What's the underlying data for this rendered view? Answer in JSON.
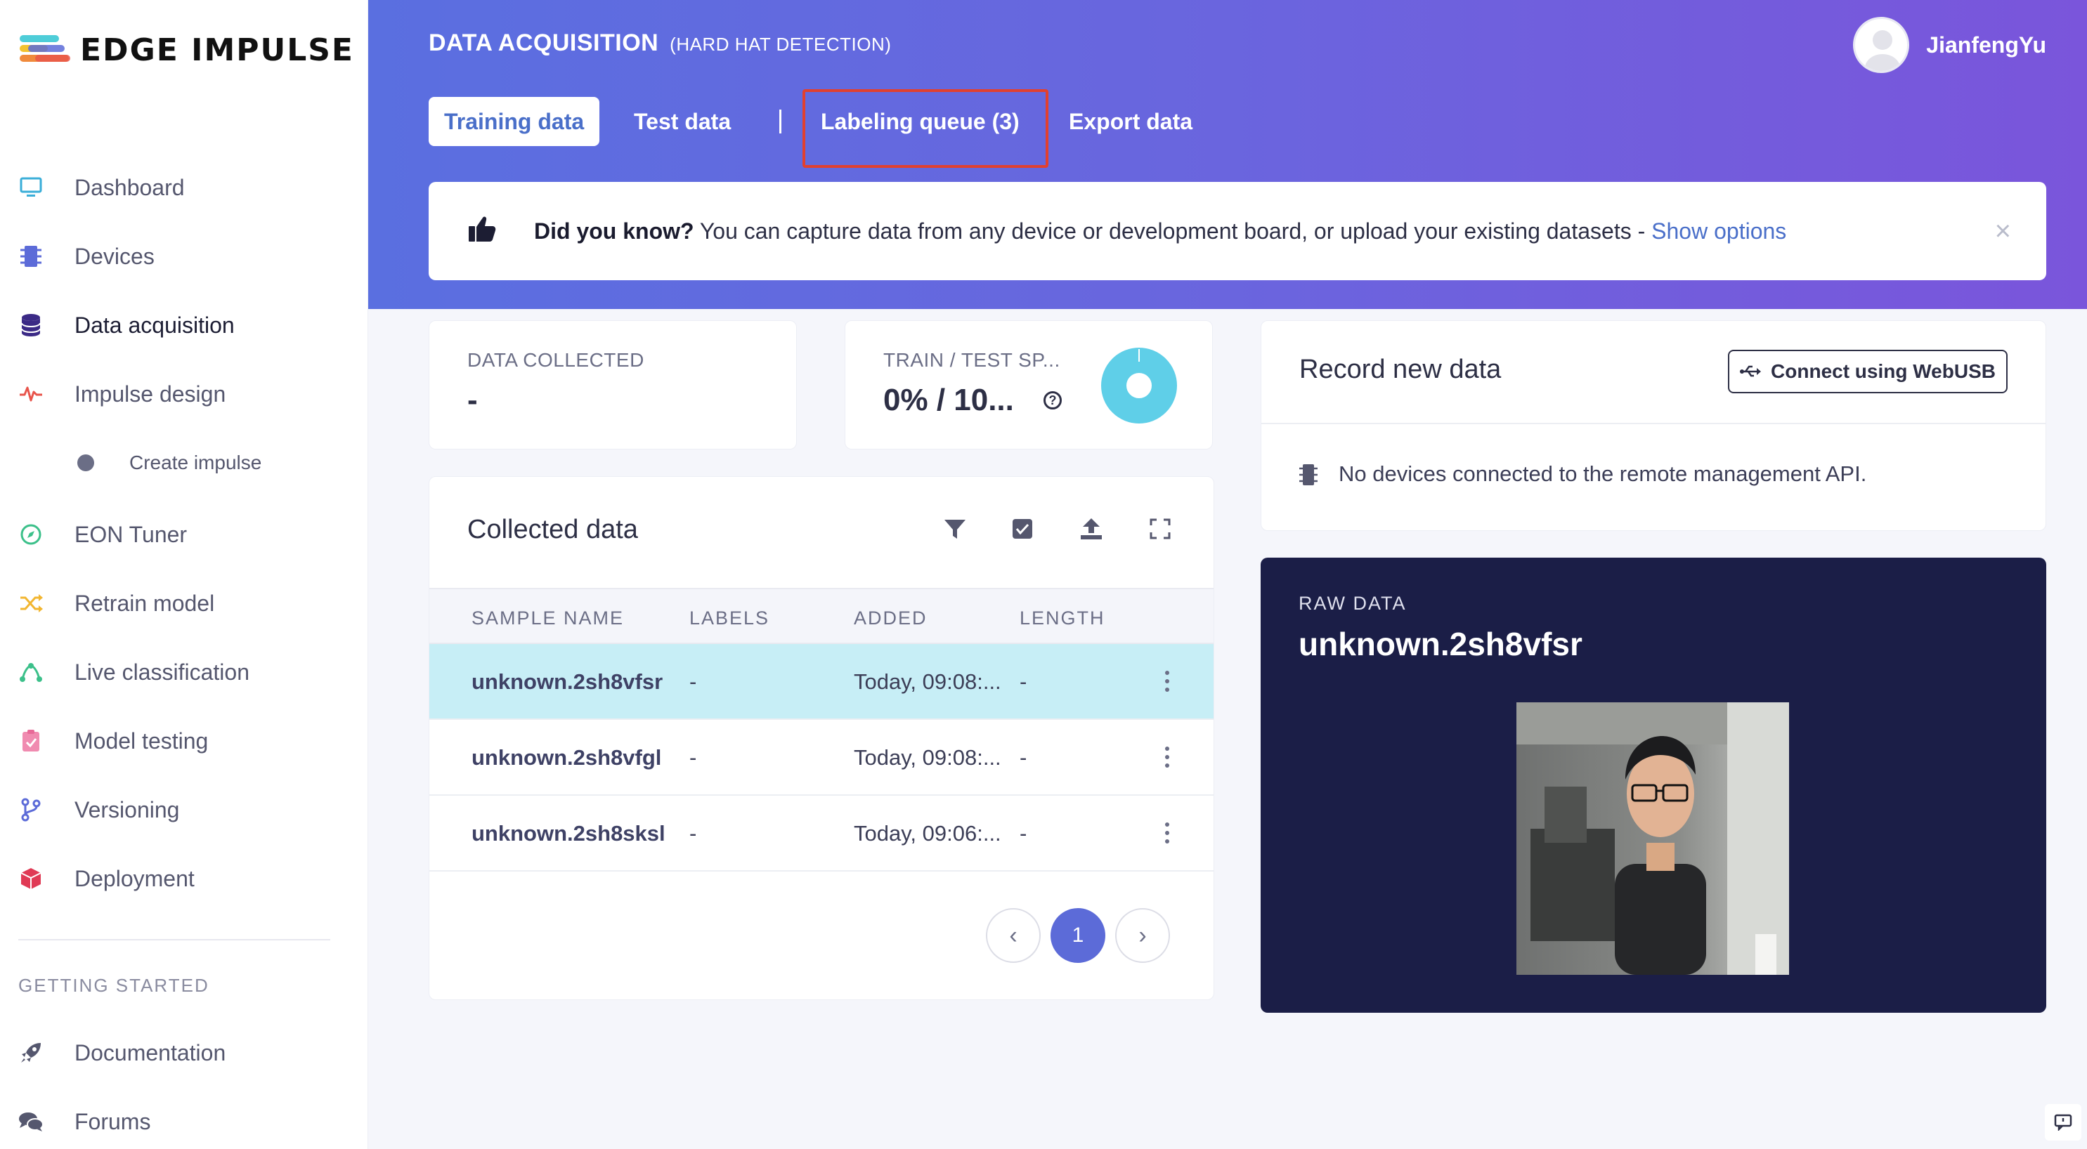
{
  "brand": {
    "name": "EDGE IMPULSE"
  },
  "sidebar": {
    "items": [
      {
        "label": "Dashboard",
        "icon": "monitor-icon"
      },
      {
        "label": "Devices",
        "icon": "chip-icon"
      },
      {
        "label": "Data acquisition",
        "icon": "database-icon",
        "active": true
      },
      {
        "label": "Impulse design",
        "icon": "pulse-icon"
      },
      {
        "label": "Create impulse",
        "icon": "dot-icon"
      },
      {
        "label": "EON Tuner",
        "icon": "compass-icon"
      },
      {
        "label": "Retrain model",
        "icon": "shuffle-icon"
      },
      {
        "label": "Live classification",
        "icon": "network-icon"
      },
      {
        "label": "Model testing",
        "icon": "clipboard-check-icon"
      },
      {
        "label": "Versioning",
        "icon": "branch-icon"
      },
      {
        "label": "Deployment",
        "icon": "box-icon"
      }
    ],
    "section_title": "GETTING STARTED",
    "getting_started": [
      {
        "label": "Documentation",
        "icon": "rocket-icon"
      },
      {
        "label": "Forums",
        "icon": "chat-bubbles-icon"
      }
    ]
  },
  "header": {
    "title": "DATA ACQUISITION",
    "project": "(HARD HAT DETECTION)",
    "tabs": [
      {
        "label": "Training data",
        "active": true
      },
      {
        "label": "Test data"
      },
      {
        "label": "Labeling queue (3)"
      },
      {
        "label": "Export data"
      }
    ],
    "user": {
      "name": "JianfengYu"
    }
  },
  "tip": {
    "bold": "Did you know?",
    "text": " You can capture data from any device or development board, or upload your existing datasets - ",
    "link": "Show options",
    "close": "×"
  },
  "stats": {
    "collected_label": "DATA COLLECTED",
    "collected_value": "-",
    "split_label": "TRAIN / TEST SP...",
    "split_value": "0% / 10...",
    "help": "?"
  },
  "collected": {
    "title": "Collected data",
    "columns": [
      "SAMPLE NAME",
      "LABELS",
      "ADDED",
      "LENGTH"
    ],
    "rows": [
      {
        "name": "unknown.2sh8vfsr",
        "labels": "-",
        "added": "Today, 09:08:...",
        "length": "-"
      },
      {
        "name": "unknown.2sh8vfgl",
        "labels": "-",
        "added": "Today, 09:08:...",
        "length": "-"
      },
      {
        "name": "unknown.2sh8sksl",
        "labels": "-",
        "added": "Today, 09:06:...",
        "length": "-"
      }
    ],
    "pager": {
      "prev": "‹",
      "current": "1",
      "next": "›"
    }
  },
  "record": {
    "title": "Record new data",
    "button": "Connect using WebUSB",
    "message": "No devices connected to the remote management API."
  },
  "raw": {
    "label": "RAW DATA",
    "name": "unknown.2sh8vfsr"
  },
  "colors": {
    "accent": "#5c6bd8",
    "highlight": "#e1402f",
    "selected_row": "#c7eef6",
    "raw_bg": "#1b1e47"
  }
}
